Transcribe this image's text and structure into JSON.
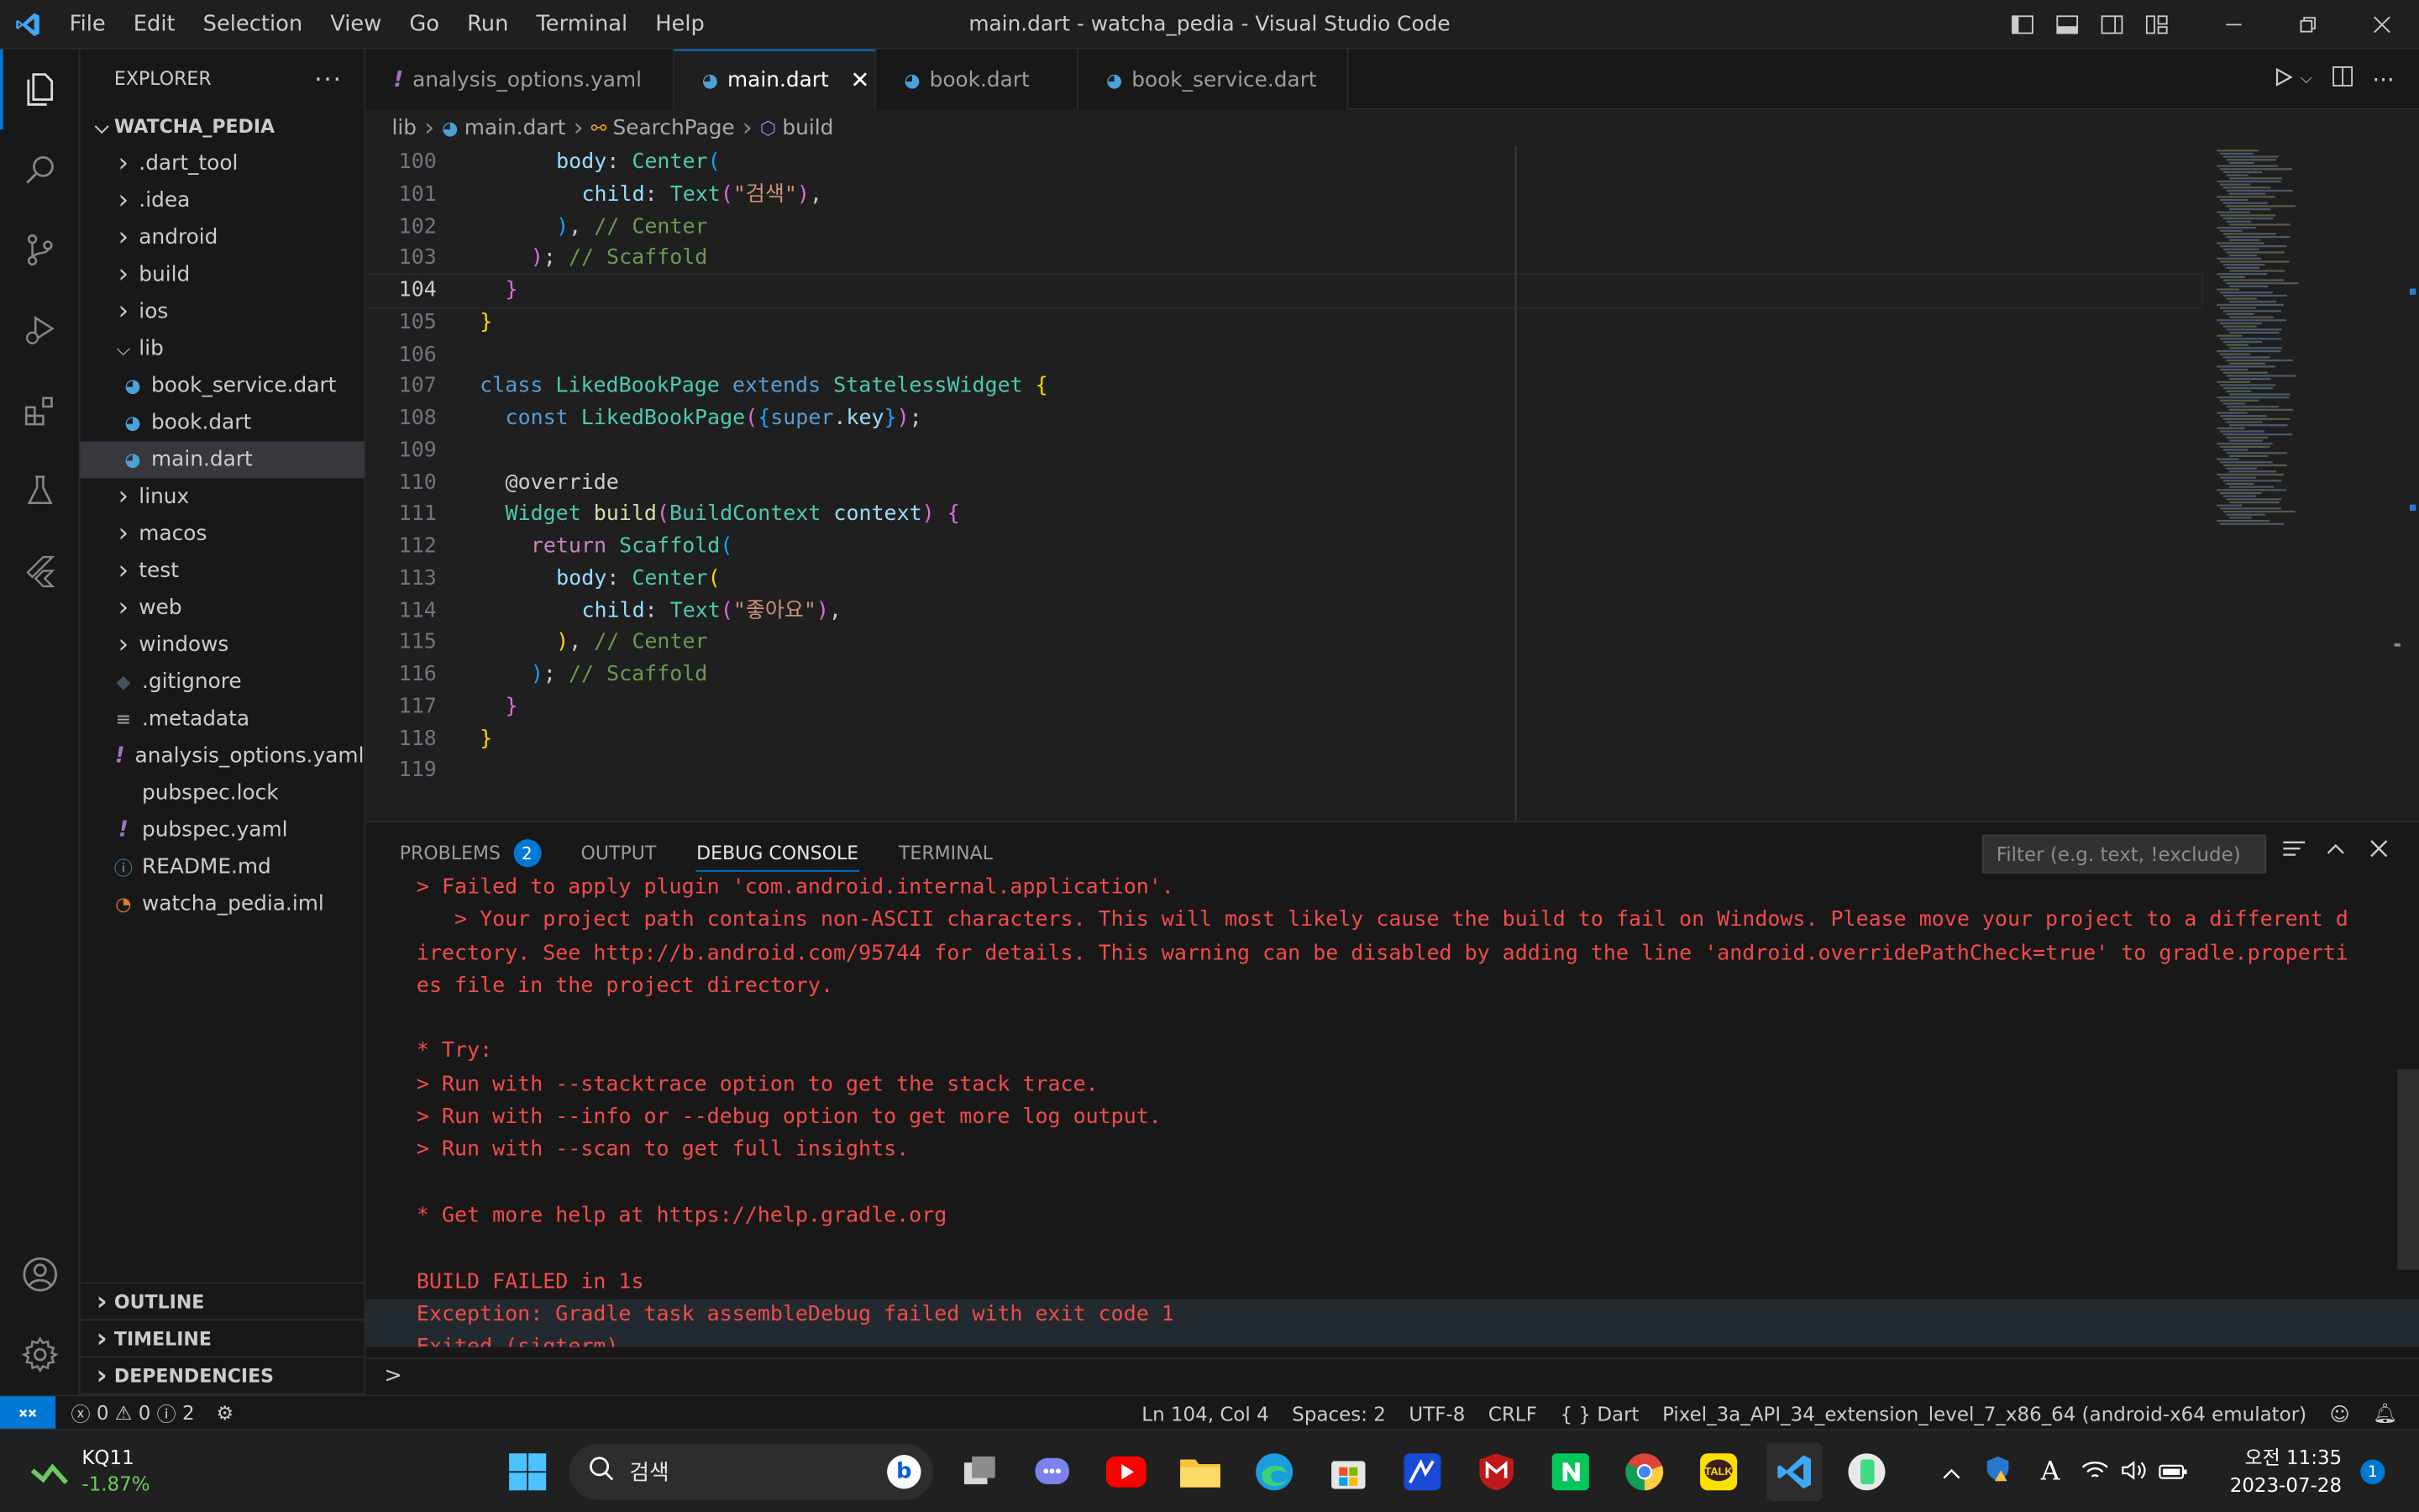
{
  "titlebar": {
    "menu": [
      "File",
      "Edit",
      "Selection",
      "View",
      "Go",
      "Run",
      "Terminal",
      "Help"
    ],
    "title": "main.dart - watcha_pedia - Visual Studio Code"
  },
  "sidebar": {
    "header": "EXPLORER",
    "root": "WATCHA_PEDIA",
    "items": [
      {
        "label": ".dart_tool",
        "type": "folder",
        "depth": 0
      },
      {
        "label": ".idea",
        "type": "folder",
        "depth": 0
      },
      {
        "label": "android",
        "type": "folder",
        "depth": 0
      },
      {
        "label": "build",
        "type": "folder",
        "depth": 0
      },
      {
        "label": "ios",
        "type": "folder",
        "depth": 0
      },
      {
        "label": "lib",
        "type": "folder-open",
        "depth": 0
      },
      {
        "label": "book_service.dart",
        "type": "dart",
        "depth": 1
      },
      {
        "label": "book.dart",
        "type": "dart",
        "depth": 1
      },
      {
        "label": "main.dart",
        "type": "dart",
        "depth": 1,
        "selected": true
      },
      {
        "label": "linux",
        "type": "folder",
        "depth": 0
      },
      {
        "label": "macos",
        "type": "folder",
        "depth": 0
      },
      {
        "label": "test",
        "type": "folder",
        "depth": 0
      },
      {
        "label": "web",
        "type": "folder",
        "depth": 0
      },
      {
        "label": "windows",
        "type": "folder",
        "depth": 0
      },
      {
        "label": ".gitignore",
        "type": "git",
        "depth": 0
      },
      {
        "label": ".metadata",
        "type": "lines",
        "depth": 0
      },
      {
        "label": "analysis_options.yaml",
        "type": "yaml",
        "depth": 0
      },
      {
        "label": "pubspec.lock",
        "type": "lock",
        "depth": 0
      },
      {
        "label": "pubspec.yaml",
        "type": "yaml",
        "depth": 0
      },
      {
        "label": "README.md",
        "type": "info",
        "depth": 0
      },
      {
        "label": "watcha_pedia.iml",
        "type": "rss",
        "depth": 0
      }
    ],
    "sections": [
      "OUTLINE",
      "TIMELINE",
      "DEPENDENCIES"
    ]
  },
  "tabs": [
    {
      "label": "analysis_options.yaml",
      "icon": "yaml-icon"
    },
    {
      "label": "main.dart",
      "icon": "dart-icon",
      "active": true
    },
    {
      "label": "book.dart",
      "icon": "dart-icon"
    },
    {
      "label": "book_service.dart",
      "icon": "dart-icon"
    }
  ],
  "breadcrumb": [
    "lib",
    "main.dart",
    "SearchPage",
    "build"
  ],
  "code": {
    "current_line": "104",
    "lines": [
      {
        "n": "100",
        "i": 3,
        "t": [
          [
            "pr",
            "body"
          ],
          [
            "p",
            ": "
          ],
          [
            "ty",
            "Center"
          ],
          [
            "bB",
            "("
          ]
        ]
      },
      {
        "n": "101",
        "i": 4,
        "t": [
          [
            "pr",
            "child"
          ],
          [
            "p",
            ": "
          ],
          [
            "ty",
            "Text"
          ],
          [
            "bP",
            "("
          ],
          [
            "st",
            "\"검색\""
          ],
          [
            "bP",
            ")"
          ],
          [
            "p",
            ","
          ]
        ]
      },
      {
        "n": "102",
        "i": 3,
        "t": [
          [
            "bB",
            ")"
          ],
          [
            "p",
            ", "
          ],
          [
            "cm",
            "// Center"
          ]
        ]
      },
      {
        "n": "103",
        "i": 2,
        "t": [
          [
            "bP",
            ")"
          ],
          [
            "p",
            "; "
          ],
          [
            "cm",
            "// Scaffold"
          ]
        ]
      },
      {
        "n": "104",
        "i": 1,
        "t": [
          [
            "bP",
            "}"
          ]
        ]
      },
      {
        "n": "105",
        "i": 0,
        "t": [
          [
            "bY",
            "}"
          ]
        ]
      },
      {
        "n": "106",
        "i": 0,
        "t": []
      },
      {
        "n": "107",
        "i": 0,
        "t": [
          [
            "kw",
            "class "
          ],
          [
            "ty",
            "LikedBookPage "
          ],
          [
            "kw",
            "extends "
          ],
          [
            "ty",
            "StatelessWidget "
          ],
          [
            "bY",
            "{"
          ]
        ]
      },
      {
        "n": "108",
        "i": 1,
        "t": [
          [
            "kw",
            "const "
          ],
          [
            "ty",
            "LikedBookPage"
          ],
          [
            "bP",
            "("
          ],
          [
            "bB",
            "{"
          ],
          [
            "kw",
            "super"
          ],
          [
            "p",
            "."
          ],
          [
            "pr",
            "key"
          ],
          [
            "bB",
            "}"
          ],
          [
            "bP",
            ")"
          ],
          [
            "p",
            ";"
          ]
        ]
      },
      {
        "n": "109",
        "i": 0,
        "t": []
      },
      {
        "n": "110",
        "i": 1,
        "t": [
          [
            "p",
            "@override"
          ]
        ]
      },
      {
        "n": "111",
        "i": 1,
        "t": [
          [
            "ty",
            "Widget "
          ],
          [
            "fn",
            "build"
          ],
          [
            "bP",
            "("
          ],
          [
            "ty",
            "BuildContext "
          ],
          [
            "pr",
            "context"
          ],
          [
            "bP",
            ")"
          ],
          [
            "p",
            " "
          ],
          [
            "bP",
            "{"
          ]
        ]
      },
      {
        "n": "112",
        "i": 2,
        "t": [
          [
            "ctl",
            "return "
          ],
          [
            "ty",
            "Scaffold"
          ],
          [
            "bB",
            "("
          ]
        ]
      },
      {
        "n": "113",
        "i": 3,
        "t": [
          [
            "pr",
            "body"
          ],
          [
            "p",
            ": "
          ],
          [
            "ty",
            "Center"
          ],
          [
            "bY",
            "("
          ]
        ]
      },
      {
        "n": "114",
        "i": 4,
        "t": [
          [
            "pr",
            "child"
          ],
          [
            "p",
            ": "
          ],
          [
            "ty",
            "Text"
          ],
          [
            "bP",
            "("
          ],
          [
            "st",
            "\"좋아요\""
          ],
          [
            "bP",
            ")"
          ],
          [
            "p",
            ","
          ]
        ]
      },
      {
        "n": "115",
        "i": 3,
        "t": [
          [
            "bY",
            ")"
          ],
          [
            "p",
            ", "
          ],
          [
            "cm",
            "// Center"
          ]
        ]
      },
      {
        "n": "116",
        "i": 2,
        "t": [
          [
            "bB",
            ")"
          ],
          [
            "p",
            "; "
          ],
          [
            "cm",
            "// Scaffold"
          ]
        ]
      },
      {
        "n": "117",
        "i": 1,
        "t": [
          [
            "bP",
            "}"
          ]
        ]
      },
      {
        "n": "118",
        "i": 0,
        "t": [
          [
            "bY",
            "}"
          ]
        ]
      },
      {
        "n": "119",
        "i": 0,
        "t": []
      }
    ]
  },
  "panel": {
    "tabs": [
      "PROBLEMS",
      "OUTPUT",
      "DEBUG CONSOLE",
      "TERMINAL"
    ],
    "problems_count": "2",
    "filter_placeholder": "Filter (e.g. text, !exclude)",
    "console": [
      "> Failed to apply plugin 'com.android.internal.application'.",
      "   > Your project path contains non-ASCII characters. This will most likely cause the build to fail on Windows. Please move your project to a different d",
      "irectory. See http://b.android.com/95744 for details. This warning can be disabled by adding the line 'android.overridePathCheck=true' to gradle.properti",
      "es file in the project directory.",
      "",
      "* Try:",
      "> Run with --stacktrace option to get the stack trace.",
      "> Run with --info or --debug option to get more log output.",
      "> Run with --scan to get full insights.",
      "",
      "* Get more help at https://help.gradle.org",
      "",
      "BUILD FAILED in 1s",
      "Exception: Gradle task assembleDebug failed with exit code 1",
      "Exited (sigterm)"
    ],
    "prompt": ">"
  },
  "statusbar": {
    "errors": "0",
    "warnings": "0",
    "info": "2",
    "position": "Ln 104, Col 4",
    "spaces": "Spaces: 2",
    "encoding": "UTF-8",
    "eol": "CRLF",
    "language": "Dart",
    "device": "Pixel_3a_API_34_extension_level_7_x86_64 (android-x64 emulator)"
  },
  "taskbar": {
    "stock_name": "KQ11",
    "stock_change": "-1.87%",
    "search_placeholder": "검색",
    "time": "오전 11:35",
    "date": "2023-07-28",
    "notifications": "1",
    "ime": "A"
  },
  "colors": {
    "accent": "#0078d4",
    "error_text": "#f14c4c"
  }
}
